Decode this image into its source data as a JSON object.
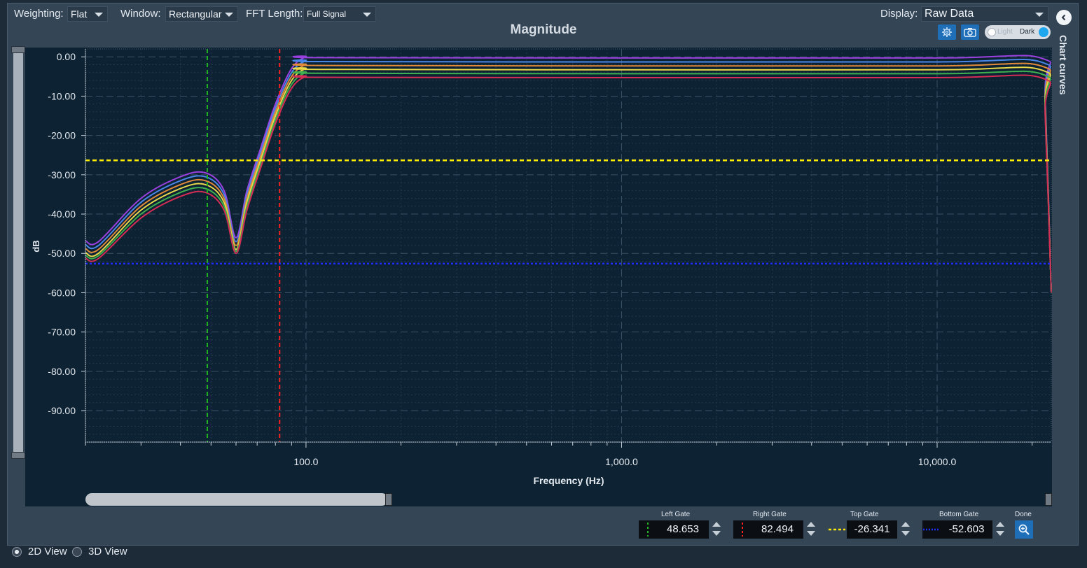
{
  "toolbar": {
    "weighting_label": "Weighting:",
    "weighting_value": "Flat",
    "window_label": "Window:",
    "window_value": "Rectangular",
    "fft_label": "FFT Length:",
    "fft_value": "Full Signal",
    "display_label": "Display:",
    "display_value": "Raw Data",
    "settings_icon": "gear-icon",
    "camera_icon": "camera-icon",
    "theme_light": "Light",
    "theme_dark": "Dark",
    "theme_selected": "Dark"
  },
  "side_panel": {
    "title": "Chart curves",
    "collapse_icon": "chevron-left-icon"
  },
  "chart_data": {
    "type": "line",
    "title": "Magnitude",
    "xlabel": "Frequency (Hz)",
    "ylabel": "dB",
    "x_scale": "log",
    "xlim": [
      20,
      23000
    ],
    "ylim": [
      -98,
      2
    ],
    "grid": true,
    "x_tick_labels": [
      "100.0",
      "1,000.0",
      "10,000.0"
    ],
    "x_ticks": [
      100,
      1000,
      10000
    ],
    "y_tick_labels": [
      "0.00",
      "-10.00",
      "-20.00",
      "-30.00",
      "-40.00",
      "-50.00",
      "-60.00",
      "-70.00",
      "-80.00",
      "-90.00"
    ],
    "y_ticks": [
      0,
      -10,
      -20,
      -30,
      -40,
      -50,
      -60,
      -70,
      -80,
      -90
    ],
    "colors": [
      "#9b40e0",
      "#4a86e8",
      "#e08a3a",
      "#e8d84a",
      "#3fb04f",
      "#d42c55"
    ],
    "series": [
      {
        "x": [
          20,
          22,
          30,
          40,
          48,
          55,
          60,
          65,
          72,
          80,
          90,
          100,
          110,
          1000,
          10000,
          21500,
          22000,
          23000
        ],
        "values": [
          -46.8,
          -47,
          -36,
          -30.5,
          -29.5,
          -34,
          -46,
          -34,
          -23,
          -12,
          -3,
          0,
          -0.2,
          -0.3,
          -0.3,
          -0.4,
          -10,
          -60
        ]
      },
      {
        "x": [
          20,
          22,
          30,
          40,
          48,
          55,
          60,
          65,
          72,
          80,
          90,
          100,
          110,
          1000,
          10000,
          21500,
          22000,
          23000
        ],
        "values": [
          -47.8,
          -48,
          -37,
          -31.5,
          -30.5,
          -35,
          -47,
          -35,
          -24,
          -13,
          -4,
          -1,
          -1.2,
          -1.3,
          -1.3,
          -1.4,
          -11,
          -60
        ]
      },
      {
        "x": [
          20,
          22,
          30,
          40,
          48,
          55,
          60,
          65,
          72,
          80,
          90,
          100,
          110,
          1000,
          10000,
          21500,
          22000,
          23000
        ],
        "values": [
          -48.8,
          -49,
          -38,
          -32.5,
          -31.5,
          -36,
          -48,
          -36,
          -25,
          -14,
          -5,
          -2,
          -2.2,
          -2.3,
          -2.3,
          -2.4,
          -12,
          -60
        ]
      },
      {
        "x": [
          20,
          22,
          30,
          40,
          48,
          55,
          60,
          65,
          72,
          80,
          90,
          100,
          110,
          1000,
          10000,
          21500,
          22000,
          23000
        ],
        "values": [
          -49.8,
          -50,
          -39,
          -33.5,
          -32.5,
          -37,
          -49,
          -37,
          -26,
          -15,
          -6,
          -3,
          -3.2,
          -3.3,
          -3.3,
          -3.4,
          -13,
          -60
        ]
      },
      {
        "x": [
          20,
          22,
          30,
          40,
          48,
          55,
          60,
          65,
          72,
          80,
          90,
          100,
          110,
          1000,
          10000,
          21500,
          22000,
          23000
        ],
        "values": [
          -50.5,
          -50.6,
          -40,
          -34.5,
          -33.5,
          -38,
          -49.5,
          -38,
          -27,
          -16,
          -7,
          -4,
          -4.2,
          -4.3,
          -4.3,
          -4.4,
          -14,
          -60
        ]
      },
      {
        "x": [
          20,
          22,
          30,
          40,
          48,
          55,
          60,
          65,
          72,
          80,
          90,
          100,
          110,
          1000,
          10000,
          21500,
          22000,
          23000
        ],
        "values": [
          -51.2,
          -51.3,
          -41,
          -35.5,
          -34.5,
          -39,
          -50,
          -39,
          -28,
          -17,
          -8,
          -5,
          -5.2,
          -5.3,
          -5.3,
          -5.4,
          -15,
          -60
        ]
      }
    ],
    "gates": [
      {
        "name": "Left Gate",
        "axis": "x",
        "value": 48.653,
        "color": "#22b422",
        "style": "dashed"
      },
      {
        "name": "Right Gate",
        "axis": "x",
        "value": 82.494,
        "color": "#ff2020",
        "style": "dashed"
      },
      {
        "name": "Top Gate",
        "axis": "y",
        "value": -26.341,
        "color": "#ffee00",
        "style": "dashed"
      },
      {
        "name": "Bottom Gate",
        "axis": "y",
        "value": -52.603,
        "color": "#1f2cff",
        "style": "dotted"
      }
    ]
  },
  "gates_panel": {
    "left_label": "Left Gate",
    "left_value": "48.653",
    "right_label": "Right Gate",
    "right_value": "82.494",
    "top_label": "Top Gate",
    "top_value": "-26.341",
    "bottom_label": "Bottom Gate",
    "bottom_value": "-52.603",
    "done_label": "Done",
    "done_icon": "zoom-icon"
  },
  "views": {
    "view_2d": "2D View",
    "view_3d": "3D View",
    "selected": "2D View"
  }
}
